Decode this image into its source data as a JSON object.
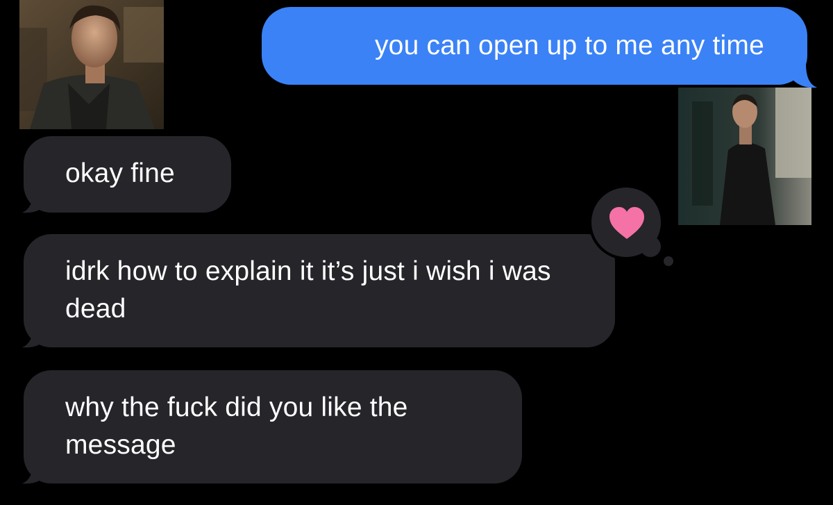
{
  "conversation": {
    "messages": [
      {
        "direction": "outgoing",
        "text": "you can open up to me any time"
      },
      {
        "direction": "incoming",
        "text": "okay fine"
      },
      {
        "direction": "incoming",
        "text": "idrk how to explain it it’s just i wish i was dead",
        "reaction": "heart-icon"
      },
      {
        "direction": "incoming",
        "text": "why the fuck did you like the message"
      }
    ]
  },
  "participants": {
    "left": {
      "avatar": "person-photo"
    },
    "right": {
      "avatar": "person-photo"
    }
  },
  "colors": {
    "background": "#000000",
    "incoming_bubble": "#26252a",
    "outgoing_bubble": "#3b82f6",
    "heart": "#f472a6",
    "text": "#ffffff"
  }
}
